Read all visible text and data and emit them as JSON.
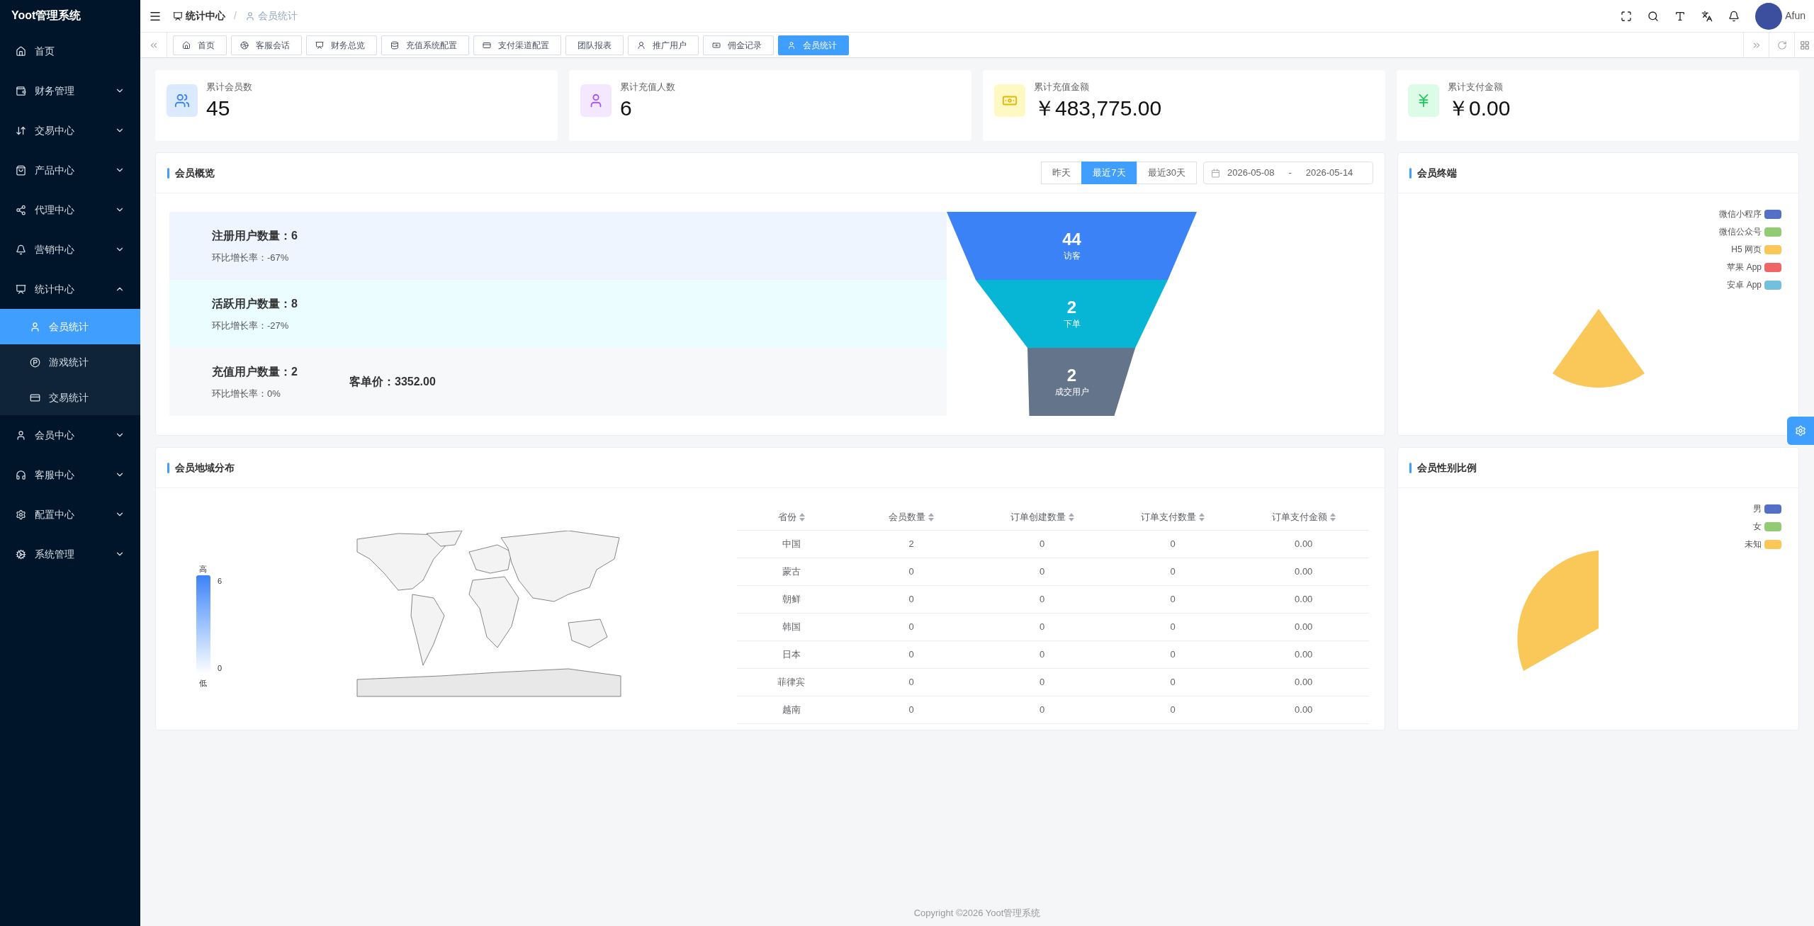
{
  "sidebar": {
    "title": "Yoot管理系统",
    "items": [
      {
        "kind": "link",
        "label": "首页",
        "selected": false
      },
      {
        "kind": "submenu",
        "label": "财务管理",
        "expanded": false
      },
      {
        "kind": "submenu",
        "label": "交易中心",
        "expanded": false
      },
      {
        "kind": "submenu",
        "label": "产品中心",
        "expanded": false
      },
      {
        "kind": "submenu",
        "label": "代理中心",
        "expanded": false
      },
      {
        "kind": "submenu",
        "label": "营销中心",
        "expanded": false
      },
      {
        "kind": "submenu",
        "label": "统计中心",
        "expanded": true,
        "children": [
          {
            "label": "会员统计",
            "selected": true
          },
          {
            "label": "游戏统计",
            "selected": false
          },
          {
            "label": "交易统计",
            "selected": false
          }
        ]
      },
      {
        "kind": "submenu",
        "label": "会员中心",
        "expanded": false
      },
      {
        "kind": "submenu",
        "label": "客服中心",
        "expanded": false
      },
      {
        "kind": "submenu",
        "label": "配置中心",
        "expanded": false
      },
      {
        "kind": "submenu",
        "label": "系统管理",
        "expanded": false
      }
    ]
  },
  "top_bar": {
    "breadcrumb": [
      {
        "label": "统计中心"
      },
      {
        "label": "会员统计"
      }
    ],
    "separator": "/",
    "user_name": "Afun"
  },
  "tabs": [
    {
      "label": "首页",
      "selected": false
    },
    {
      "label": "客服会话",
      "selected": false
    },
    {
      "label": "财务总览",
      "selected": false
    },
    {
      "label": "充值系统配置",
      "selected": false
    },
    {
      "label": "支付渠道配置",
      "selected": false
    },
    {
      "label": "团队报表",
      "selected": false
    },
    {
      "label": "推广用户",
      "selected": false
    },
    {
      "label": "佣金记录",
      "selected": false
    },
    {
      "label": "会员统计",
      "selected": true
    }
  ],
  "stats": [
    {
      "label": "累计会员数",
      "value": "45"
    },
    {
      "label": "累计充值人数",
      "value": "6"
    },
    {
      "label": "累计充值金额",
      "value": "￥483,775.00"
    },
    {
      "label": "累计支付金额",
      "value": "￥0.00"
    }
  ],
  "overview": {
    "title": "会员概览",
    "range_buttons": [
      {
        "label": "昨天",
        "selected": false
      },
      {
        "label": "最近7天",
        "selected": true
      },
      {
        "label": "最近30天",
        "selected": false
      }
    ],
    "date_range": {
      "start": "2026-05-08",
      "separator": "-",
      "end": "2026-05-14"
    },
    "funnel": [
      {
        "title": "注册用户数量：6",
        "growth": "环比增长率：-67%",
        "stage_value": "44",
        "stage_label": "访客",
        "color": "#3b82f6"
      },
      {
        "title": "活跃用户数量：8",
        "growth": "环比增长率：-27%",
        "stage_value": "2",
        "stage_label": "下单",
        "color": "#06b6d4"
      },
      {
        "title": "充值用户数量：2",
        "growth": "环比增长率：0%",
        "note": "客单价：3352.00",
        "stage_value": "2",
        "stage_label": "成交用户",
        "color": "#64748b"
      }
    ]
  },
  "region": {
    "title": "会员地域分布",
    "visual_map": {
      "high": "高",
      "max": "6",
      "min": "0",
      "low": "低"
    },
    "columns": [
      "省份",
      "会员数量",
      "订单创建数量",
      "订单支付数量",
      "订单支付金额"
    ],
    "rows": [
      [
        "中国",
        "2",
        "0",
        "0",
        "0.00"
      ],
      [
        "蒙古",
        "0",
        "0",
        "0",
        "0.00"
      ],
      [
        "朝鲜",
        "0",
        "0",
        "0",
        "0.00"
      ],
      [
        "韩国",
        "0",
        "0",
        "0",
        "0.00"
      ],
      [
        "日本",
        "0",
        "0",
        "0",
        "0.00"
      ],
      [
        "菲律宾",
        "0",
        "0",
        "0",
        "0.00"
      ],
      [
        "越南",
        "0",
        "0",
        "0",
        "0.00"
      ]
    ]
  },
  "terminal": {
    "title": "会员终端",
    "legend": [
      {
        "label": "微信小程序",
        "color": "#5470c6"
      },
      {
        "label": "微信公众号",
        "color": "#91cc75"
      },
      {
        "label": "H5 网页",
        "color": "#fac858"
      },
      {
        "label": "苹果 App",
        "color": "#ee6666"
      },
      {
        "label": "安卓 App",
        "color": "#73c0de"
      }
    ]
  },
  "gender": {
    "title": "会员性别比例",
    "legend": [
      {
        "label": "男",
        "color": "#5470c6"
      },
      {
        "label": "女",
        "color": "#91cc75"
      },
      {
        "label": "未知",
        "color": "#fac858"
      }
    ]
  },
  "footer": "Copyright ©2026 Yoot管理系统"
}
